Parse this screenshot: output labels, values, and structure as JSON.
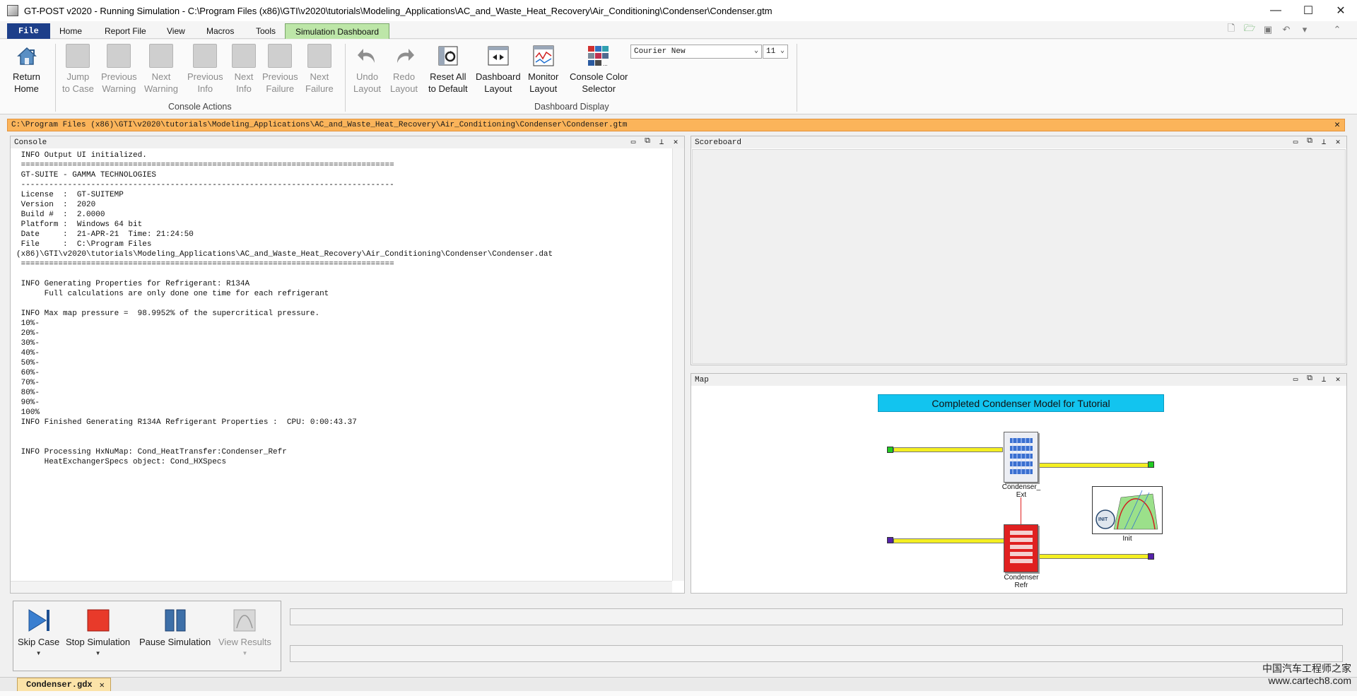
{
  "window": {
    "title": "GT-POST v2020 - Running Simulation - C:\\Program Files (x86)\\GTI\\v2020\\tutorials\\Modeling_Applications\\AC_and_Waste_Heat_Recovery\\Air_Conditioning\\Condenser\\Condenser.gtm",
    "minimize": "—",
    "maximize": "☐",
    "close": "✕"
  },
  "ribbon_tabs": [
    "File",
    "Home",
    "Report File",
    "View",
    "Macros",
    "Tools",
    "Simulation Dashboard"
  ],
  "active_tab": "Simulation Dashboard",
  "ribbon": {
    "return_home": [
      "Return",
      "Home"
    ],
    "jump_to_case": [
      "Jump",
      "to Case"
    ],
    "previous_warning": [
      "Previous",
      "Warning"
    ],
    "next_warning": [
      "Next",
      "Warning"
    ],
    "previous_info": [
      "Previous",
      "Info"
    ],
    "next_info": [
      "Next",
      "Info"
    ],
    "previous_failure": [
      "Previous",
      "Failure"
    ],
    "next_failure": [
      "Next",
      "Failure"
    ],
    "console_actions_label": "Console Actions",
    "undo_layout": [
      "Undo",
      "Layout"
    ],
    "redo_layout": [
      "Redo",
      "Layout"
    ],
    "reset_all": [
      "Reset All",
      "to Default"
    ],
    "dashboard_layout": [
      "Dashboard",
      "Layout"
    ],
    "monitor_layout": [
      "Monitor",
      "Layout"
    ],
    "console_color": [
      "Console Color",
      "Selector"
    ],
    "dashboard_display_label": "Dashboard Display",
    "font_name": "Courier New",
    "font_size": "11"
  },
  "path_bar": "C:\\Program Files (x86)\\GTI\\v2020\\tutorials\\Modeling_Applications\\AC_and_Waste_Heat_Recovery\\Air_Conditioning\\Condenser\\Condenser.gtm",
  "console": {
    "title": "Console",
    "lines": [
      " INFO Output UI initialized.",
      " ================================================================================",
      " GT-SUITE - GAMMA TECHNOLOGIES",
      " --------------------------------------------------------------------------------",
      " License  :  GT-SUITEMP",
      " Version  :  2020",
      " Build #  :  2.0000",
      " Platform :  Windows 64 bit",
      " Date     :  21-APR-21  Time: 21:24:50",
      " File     :  C:\\Program Files",
      "(x86)\\GTI\\v2020\\tutorials\\Modeling_Applications\\AC_and_Waste_Heat_Recovery\\Air_Conditioning\\Condenser\\Condenser.dat",
      " ================================================================================",
      "",
      " INFO Generating Properties for Refrigerant: R134A",
      "      Full calculations are only done one time for each refrigerant",
      "",
      " INFO Max map pressure =  98.9952% of the supercritical pressure.",
      " 10%-",
      " 20%-",
      " 30%-",
      " 40%-",
      " 50%-",
      " 60%-",
      " 70%-",
      " 80%-",
      " 90%-",
      " 100%",
      " INFO Finished Generating R134A Refrigerant Properties :  CPU: 0:00:43.37",
      "",
      "",
      " INFO Processing HxNuMap: Cond_HeatTransfer:Condenser_Refr",
      "      HeatExchangerSpecs object: Cond_HXSpecs"
    ]
  },
  "scoreboard": {
    "title": "Scoreboard"
  },
  "map": {
    "title": "Map",
    "diagram_title": "Completed Condenser Model for Tutorial",
    "condenser_ext": [
      "Condenser_",
      "Ext"
    ],
    "condenser_refr": [
      "Condenser",
      "Refr"
    ],
    "init_label": "Init",
    "init_badge": "INIT",
    "colors": {
      "title_bg": "#12c4ef",
      "pipe": "#f4ef22",
      "ext_body": "#e8e8f0",
      "refr_body": "#e02020",
      "inlet_tag": "#22cc22",
      "refr_tag": "#5522aa"
    }
  },
  "simulation_controls": {
    "skip_case": "Skip Case",
    "stop_simulation": "Stop Simulation",
    "pause_simulation": "Pause Simulation",
    "view_results": "View Results"
  },
  "document_tab": "Condenser.gdx",
  "watermark": [
    "中国汽车工程师之家",
    "www.cartech8.com"
  ]
}
